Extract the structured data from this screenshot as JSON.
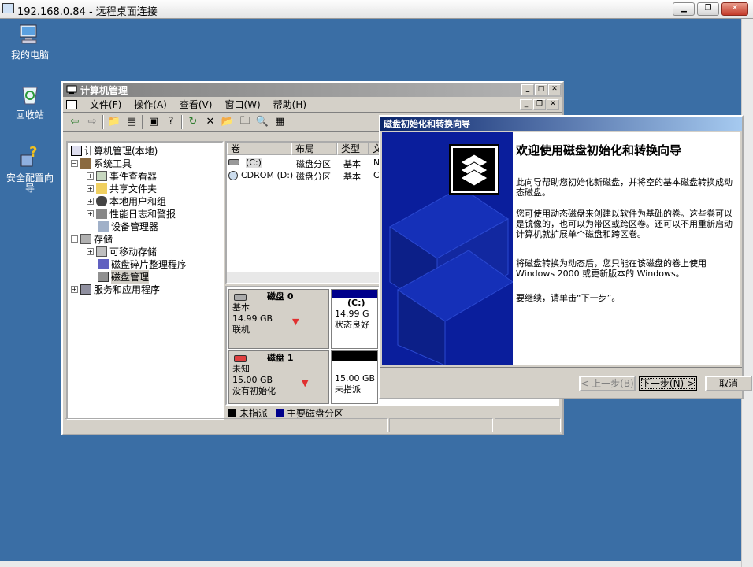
{
  "rdp": {
    "title": "192.168.0.84 - 远程桌面连接"
  },
  "desktop": {
    "icons": [
      {
        "label": "我的电脑"
      },
      {
        "label": "回收站"
      },
      {
        "label": "安全配置向导"
      }
    ]
  },
  "mmc": {
    "title": "计算机管理",
    "menu": [
      "文件(F)",
      "操作(A)",
      "查看(V)",
      "窗口(W)",
      "帮助(H)"
    ],
    "tree": {
      "root": "计算机管理(本地)",
      "system_tools": "系统工具",
      "event_viewer": "事件查看器",
      "shared_folders": "共享文件夹",
      "local_users": "本地用户和组",
      "perf_logs": "性能日志和警报",
      "device_manager": "设备管理器",
      "storage": "存储",
      "removable": "可移动存储",
      "defrag": "磁盘碎片整理程序",
      "disk_mgmt": "磁盘管理",
      "services": "服务和应用程序"
    },
    "list": {
      "headers": [
        "卷",
        "布局",
        "类型",
        "文"
      ],
      "rows": [
        {
          "vol": "(C:)",
          "layout": "磁盘分区",
          "type": "基本",
          "fs": "N"
        },
        {
          "vol": "CDROM (D:)",
          "layout": "磁盘分区",
          "type": "基本",
          "fs": "C"
        }
      ]
    },
    "disks": [
      {
        "name": "磁盘 0",
        "type": "基本",
        "size": "14.99 GB",
        "status": "联机",
        "part_label": "(C:)",
        "part_size": "14.99 G",
        "part_status": "状态良好"
      },
      {
        "name": "磁盘 1",
        "type": "未知",
        "size": "15.00 GB",
        "status": "没有初始化",
        "part_size": "15.00 GB",
        "part_status": "未指派"
      }
    ],
    "legend": {
      "unallocated": "未指派",
      "primary": "主要磁盘分区"
    }
  },
  "wizard": {
    "title": "磁盘初始化和转换向导",
    "heading": "欢迎使用磁盘初始化和转换向导",
    "p1": "此向导帮助您初始化新磁盘，并将空的基本磁盘转换成动态磁盘。",
    "p2": "您可使用动态磁盘来创建以软件为基础的卷。这些卷可以是镜像的，也可以为带区或跨区卷。还可以不用重新启动计算机就扩展单个磁盘和跨区卷。",
    "p3": "将磁盘转换为动态后，您只能在该磁盘的卷上使用 Windows 2000 或更新版本的 Windows。",
    "p4": "要继续，请单击“下一步”。",
    "back": "< 上一步(B)",
    "next": "下一步(N) >",
    "cancel": "取消"
  },
  "colors": {
    "desktop": "#3a6ea5",
    "title_active": "#0a246a",
    "wizard_left": "#0a1e9c",
    "primary_partition": "#00008b"
  }
}
